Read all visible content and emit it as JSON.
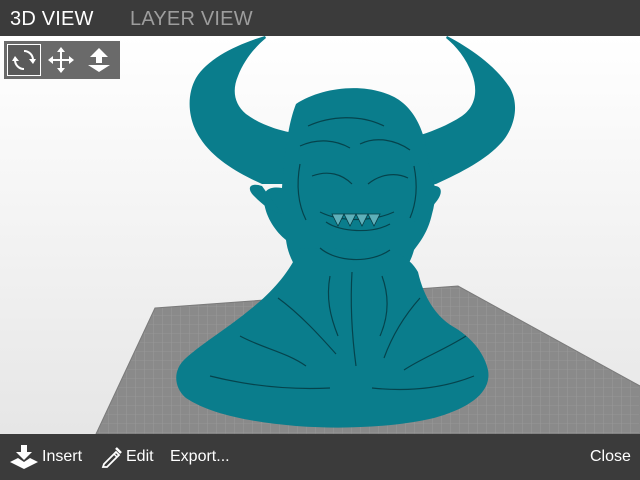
{
  "tabs": {
    "view_3d": "3D VIEW",
    "layer_view": "LAYER VIEW"
  },
  "tools": [
    {
      "id": "rotate",
      "icon": "rotate-icon",
      "active": true
    },
    {
      "id": "move",
      "icon": "move-icon",
      "active": false
    },
    {
      "id": "lift",
      "icon": "lift-icon",
      "active": false
    }
  ],
  "bottom": {
    "insert_label": "Insert",
    "edit_label": "Edit",
    "export_label": "Export...",
    "close_label": "Close"
  },
  "colors": {
    "bar": "#3b3b3b",
    "model": "#0a7d8c",
    "bed": "#8a8a8a",
    "active_tab": "#ffffff",
    "inactive_tab": "#9d9d9d"
  }
}
